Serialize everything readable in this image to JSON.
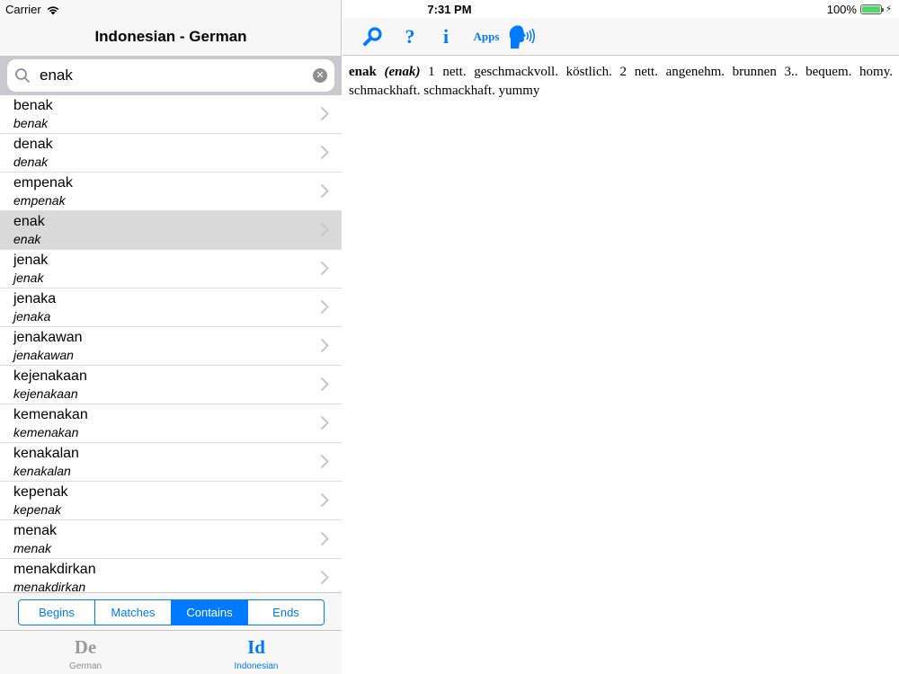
{
  "status_bar": {
    "carrier": "Carrier",
    "time": "7:31 PM",
    "battery": "100%",
    "battery_level": 1.0
  },
  "sidebar": {
    "title": "Indonesian - German",
    "search": {
      "value": "enak",
      "placeholder": ""
    },
    "results": [
      {
        "term": "benak",
        "sub": "benak",
        "selected": false
      },
      {
        "term": "denak",
        "sub": "denak",
        "selected": false
      },
      {
        "term": "empenak",
        "sub": "empenak",
        "selected": false
      },
      {
        "term": "enak",
        "sub": "enak",
        "selected": true
      },
      {
        "term": "jenak",
        "sub": "jenak",
        "selected": false
      },
      {
        "term": "jenaka",
        "sub": "jenaka",
        "selected": false
      },
      {
        "term": "jenakawan",
        "sub": "jenakawan",
        "selected": false
      },
      {
        "term": "kejenakaan",
        "sub": "kejenakaan",
        "selected": false
      },
      {
        "term": "kemenakan",
        "sub": "kemenakan",
        "selected": false
      },
      {
        "term": "kenakalan",
        "sub": "kenakalan",
        "selected": false
      },
      {
        "term": "kepenak",
        "sub": "kepenak",
        "selected": false
      },
      {
        "term": "menak",
        "sub": "menak",
        "selected": false
      },
      {
        "term": "menakdirkan",
        "sub": "menakdirkan",
        "selected": false
      }
    ],
    "segments": [
      {
        "label": "Begins",
        "active": false
      },
      {
        "label": "Matches",
        "active": false
      },
      {
        "label": "Contains",
        "active": true
      },
      {
        "label": "Ends",
        "active": false
      }
    ],
    "tabs": [
      {
        "glyph": "De",
        "label": "German",
        "active": false
      },
      {
        "glyph": "Id",
        "label": "Indonesian",
        "active": true
      }
    ]
  },
  "toolbar": {
    "help": "?",
    "info": "i",
    "apps": "Apps",
    "icons": [
      "search-icon",
      "help-icon",
      "info-icon",
      "apps-button",
      "speak-icon"
    ]
  },
  "definition": {
    "headword": "enak",
    "pronunciation": "(enak)",
    "body": " 1 nett. geschmackvoll. köstlich. 2 nett. angenehm. brunnen 3.. bequem. homy. schmackhaft. schmackhaft. yummy"
  },
  "colors": {
    "accent": "#007aff",
    "selected_row": "#d9d9d9",
    "search_bar_bg": "#c9c9ce",
    "battery": "#4cd964"
  }
}
